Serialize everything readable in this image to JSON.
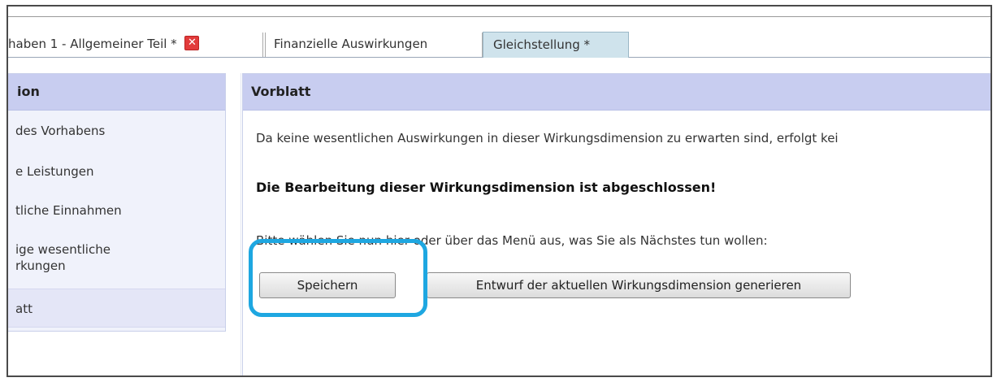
{
  "tabs": [
    {
      "label": "haben 1 - Allgemeiner Teil *",
      "has_close": true,
      "active": false
    },
    {
      "label": "Finanzielle Auswirkungen",
      "active": false
    },
    {
      "label": "Gleichstellung *",
      "active": true
    }
  ],
  "left_panel": {
    "title": "ion",
    "items": [
      {
        "label": "des Vorhabens"
      },
      {
        "label": "e Leistungen"
      },
      {
        "label": "tliche Einnahmen"
      },
      {
        "label": "ige wesentliche"
      },
      {
        "label": "rkungen"
      },
      {
        "label": "att",
        "active": true
      }
    ]
  },
  "main_panel": {
    "title": "Vorblatt",
    "info_text": "Da keine wesentlichen Auswirkungen in dieser Wirkungsdimension zu erwarten sind, erfolgt kei",
    "completed_text": "Die Bearbeitung dieser Wirkungsdimension ist abgeschlossen!",
    "prompt_text": "Bitte wählen Sie nun hier oder über das Menü aus, was Sie als Nächstes tun wollen:",
    "buttons": {
      "save_label": "Speichern",
      "generate_label": "Entwurf der aktuellen Wirkungsdimension generieren"
    }
  },
  "colors": {
    "panel_header": "#c8cdf0",
    "active_tab": "#cfe3ec",
    "highlight": "#1ea7e1",
    "close_icon": "#e23b3b"
  }
}
